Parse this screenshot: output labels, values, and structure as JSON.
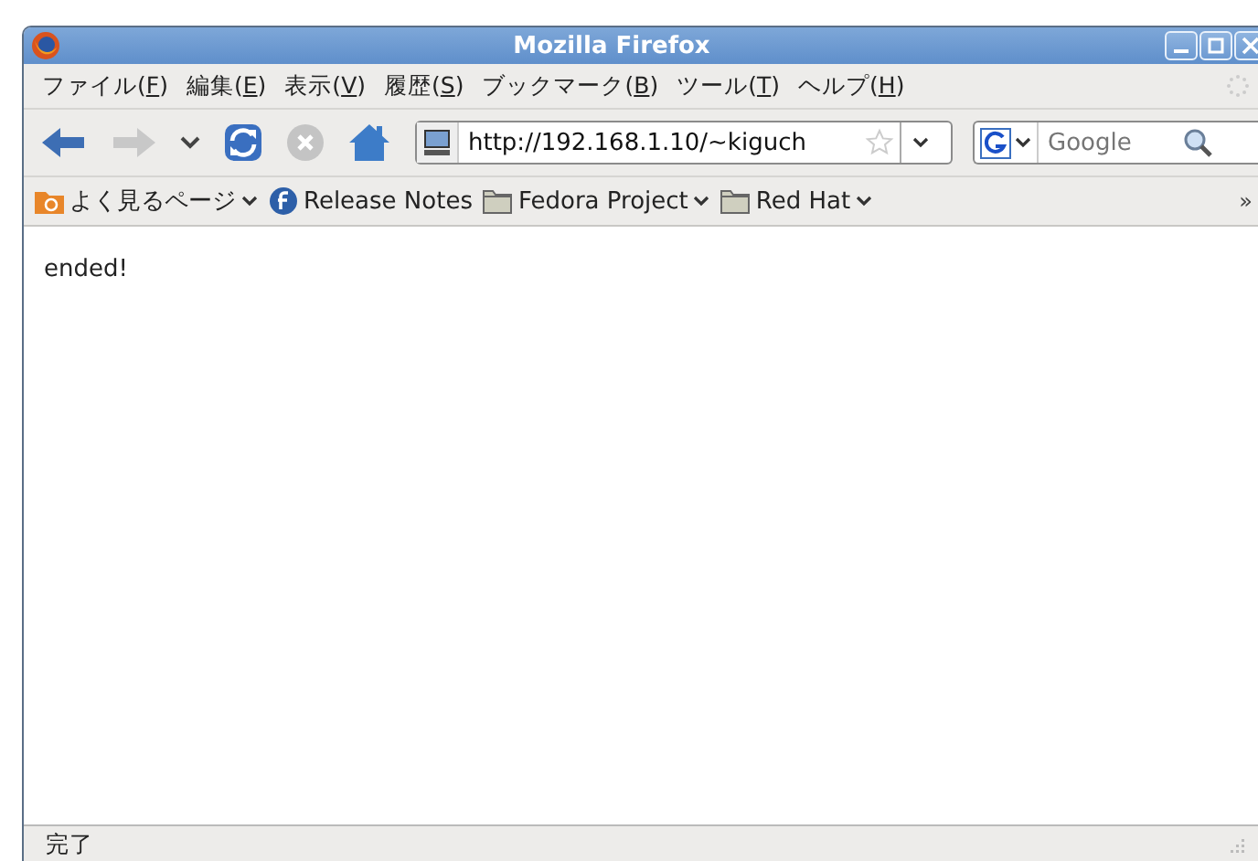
{
  "window": {
    "title": "Mozilla Firefox"
  },
  "menu": [
    {
      "before": "ファイル(",
      "key": "F",
      "after": ")"
    },
    {
      "before": "編集(",
      "key": "E",
      "after": ")"
    },
    {
      "before": "表示(",
      "key": "V",
      "after": ")"
    },
    {
      "before": "履歴(",
      "key": "S",
      "after": ")"
    },
    {
      "before": "ブックマーク(",
      "key": "B",
      "after": ")"
    },
    {
      "before": "ツール(",
      "key": "T",
      "after": ")"
    },
    {
      "before": "ヘルプ(",
      "key": "H",
      "after": ")"
    }
  ],
  "toolbar": [
    {
      "kind": "back",
      "disabled": false
    },
    {
      "kind": "forward",
      "disabled": true
    },
    {
      "kind": "history",
      "disabled": false
    },
    {
      "kind": "reload",
      "disabled": false
    },
    {
      "kind": "stop",
      "disabled": true
    },
    {
      "kind": "home",
      "disabled": false
    }
  ],
  "address": {
    "value": "http://192.168.1.10/~kiguch"
  },
  "search": {
    "placeholder": "Google"
  },
  "bookmarks": [
    {
      "kind": "smart",
      "label": "よく見るページ",
      "menu": true
    },
    {
      "kind": "fedora",
      "label": "Release Notes",
      "menu": false
    },
    {
      "kind": "folder",
      "label": "Fedora Project",
      "menu": true
    },
    {
      "kind": "folder",
      "label": "Red Hat",
      "menu": true
    }
  ],
  "bookmarks_overflow": "»",
  "content": {
    "text": "ended!"
  },
  "status_bar": {
    "text": "完了"
  }
}
